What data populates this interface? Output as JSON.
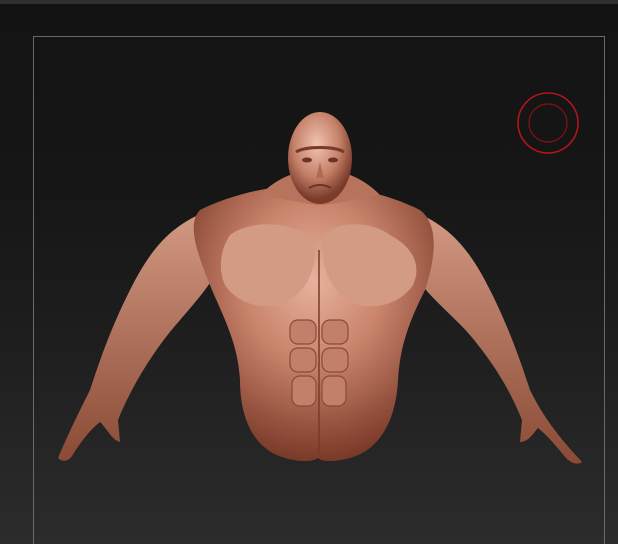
{
  "canvas": {
    "background_top": "#131313",
    "background_bottom": "#2c2c2c",
    "frame_color": "#6a6a6a"
  },
  "brush": {
    "icon": "brush-cursor-icon",
    "color": "#b3141c"
  },
  "model": {
    "subject": "muscular-torso-sculpt",
    "skin_color": "#c9836b",
    "shadow_color": "#6b3426"
  }
}
